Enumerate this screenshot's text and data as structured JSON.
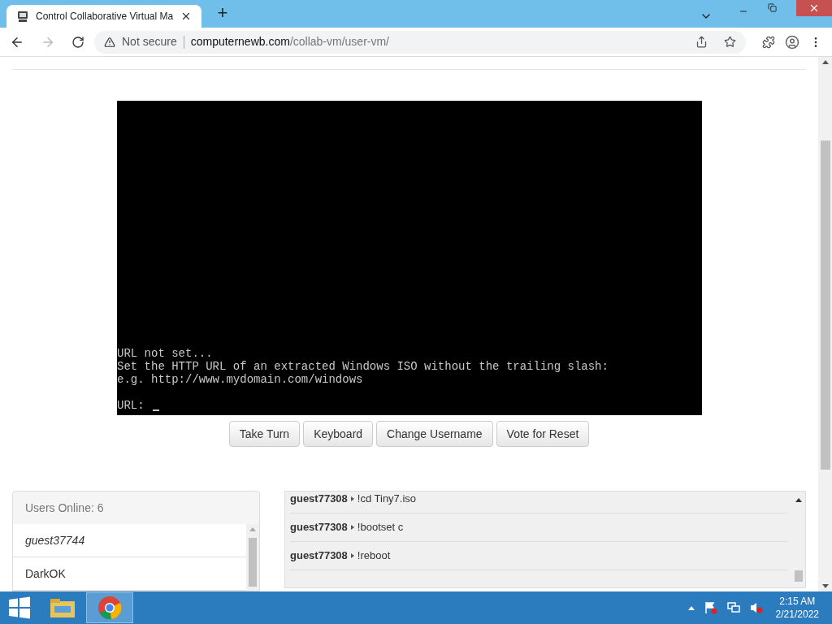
{
  "browser": {
    "tab": {
      "title": "Control Collaborative Virtual Ma",
      "selected": true
    },
    "new_tab": "+",
    "address": {
      "security": "Not secure",
      "domain": "computernewb.com",
      "path": "/collab-vm/user-vm/"
    }
  },
  "vm": {
    "lines": [
      "URL not set...",
      "Set the HTTP URL of an extracted Windows ISO without the trailing slash:",
      "e.g. http://www.mydomain.com/windows"
    ],
    "prompt": "URL:"
  },
  "buttons": [
    "Take Turn",
    "Keyboard",
    "Change Username",
    "Vote for Reset"
  ],
  "users": {
    "header": "Users Online: 6",
    "list": [
      {
        "name": "guest37744",
        "self": true
      },
      {
        "name": "DarkOK",
        "self": false
      }
    ]
  },
  "chat": [
    {
      "user": "guest77308",
      "message": "!cd Tiny7.iso"
    },
    {
      "user": "guest77308",
      "message": "!bootset c"
    },
    {
      "user": "guest77308",
      "message": "!reboot"
    }
  ],
  "taskbar": {
    "apps": [
      {
        "kind": "explorer",
        "selected": false
      },
      {
        "kind": "chrome",
        "selected": true
      }
    ],
    "time": "2:15 AM",
    "date": "2/21/2022"
  }
}
